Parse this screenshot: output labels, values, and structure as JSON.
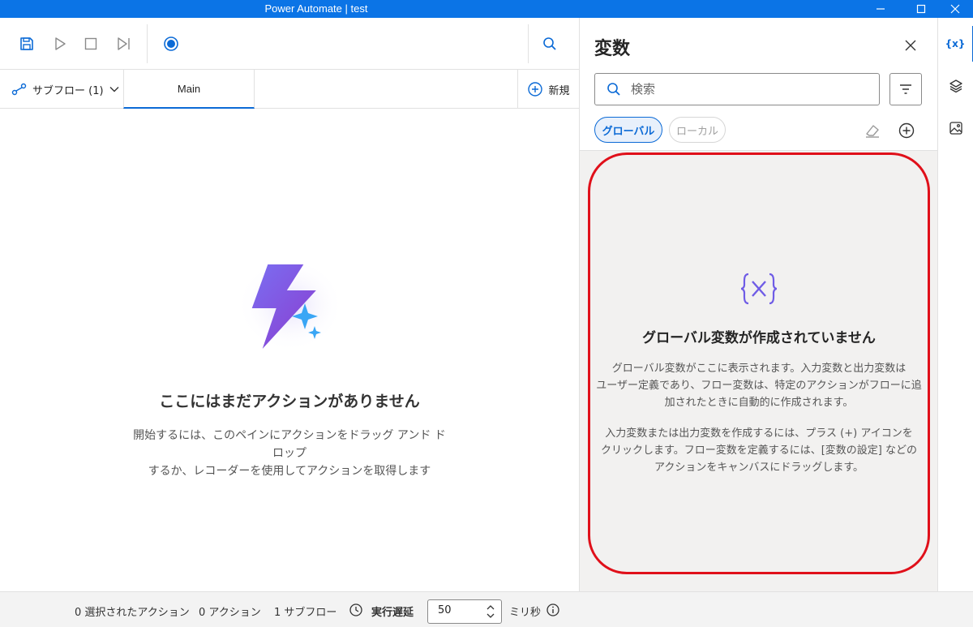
{
  "window": {
    "title": "Power Automate | test"
  },
  "tabs": {
    "subflow_label": "サブフロー (1)",
    "main_label": "Main",
    "new_label": "新規"
  },
  "canvas": {
    "empty_title": "ここにはまだアクションがありません",
    "empty_description_line1": "開始するには、このペインにアクションをドラッグ アンド ドロップ",
    "empty_description_line2": "するか、レコーダーを使用してアクションを取得します"
  },
  "variables_panel": {
    "title": "変数",
    "search_placeholder": "検索",
    "filter_global": "グローバル",
    "filter_local": "ローカル",
    "empty_title": "グローバル変数が作成されていません",
    "desc1_line1": "グローバル変数がここに表示されます。入力変数と出力変数は",
    "desc1_line2": "ユーザー定義であり、フロー変数は、特定のアクションがフローに追",
    "desc1_line3": "加されたときに自動的に作成されます。",
    "desc2_line1": "入力変数または出力変数を作成するには、プラス (+) アイコンを",
    "desc2_line2": "クリックします。フロー変数を定義するには、[変数の設定] などの",
    "desc2_line3": "アクションをキャンバスにドラッグします。",
    "highlight_color": "#e0101a"
  },
  "side_strip": {
    "items": [
      "variables-icon",
      "layers-icon",
      "images-icon"
    ],
    "variables_glyph": "{x}"
  },
  "status_bar": {
    "selected_actions": "0 選択されたアクション",
    "actions": "0 アクション",
    "subflows": "1 サブフロー",
    "run_delay_label": "実行遅延",
    "run_delay_value": "50",
    "unit": "ミリ秒"
  },
  "colors": {
    "accent": "#0b6ad6",
    "titlebar": "#0b74e6"
  }
}
